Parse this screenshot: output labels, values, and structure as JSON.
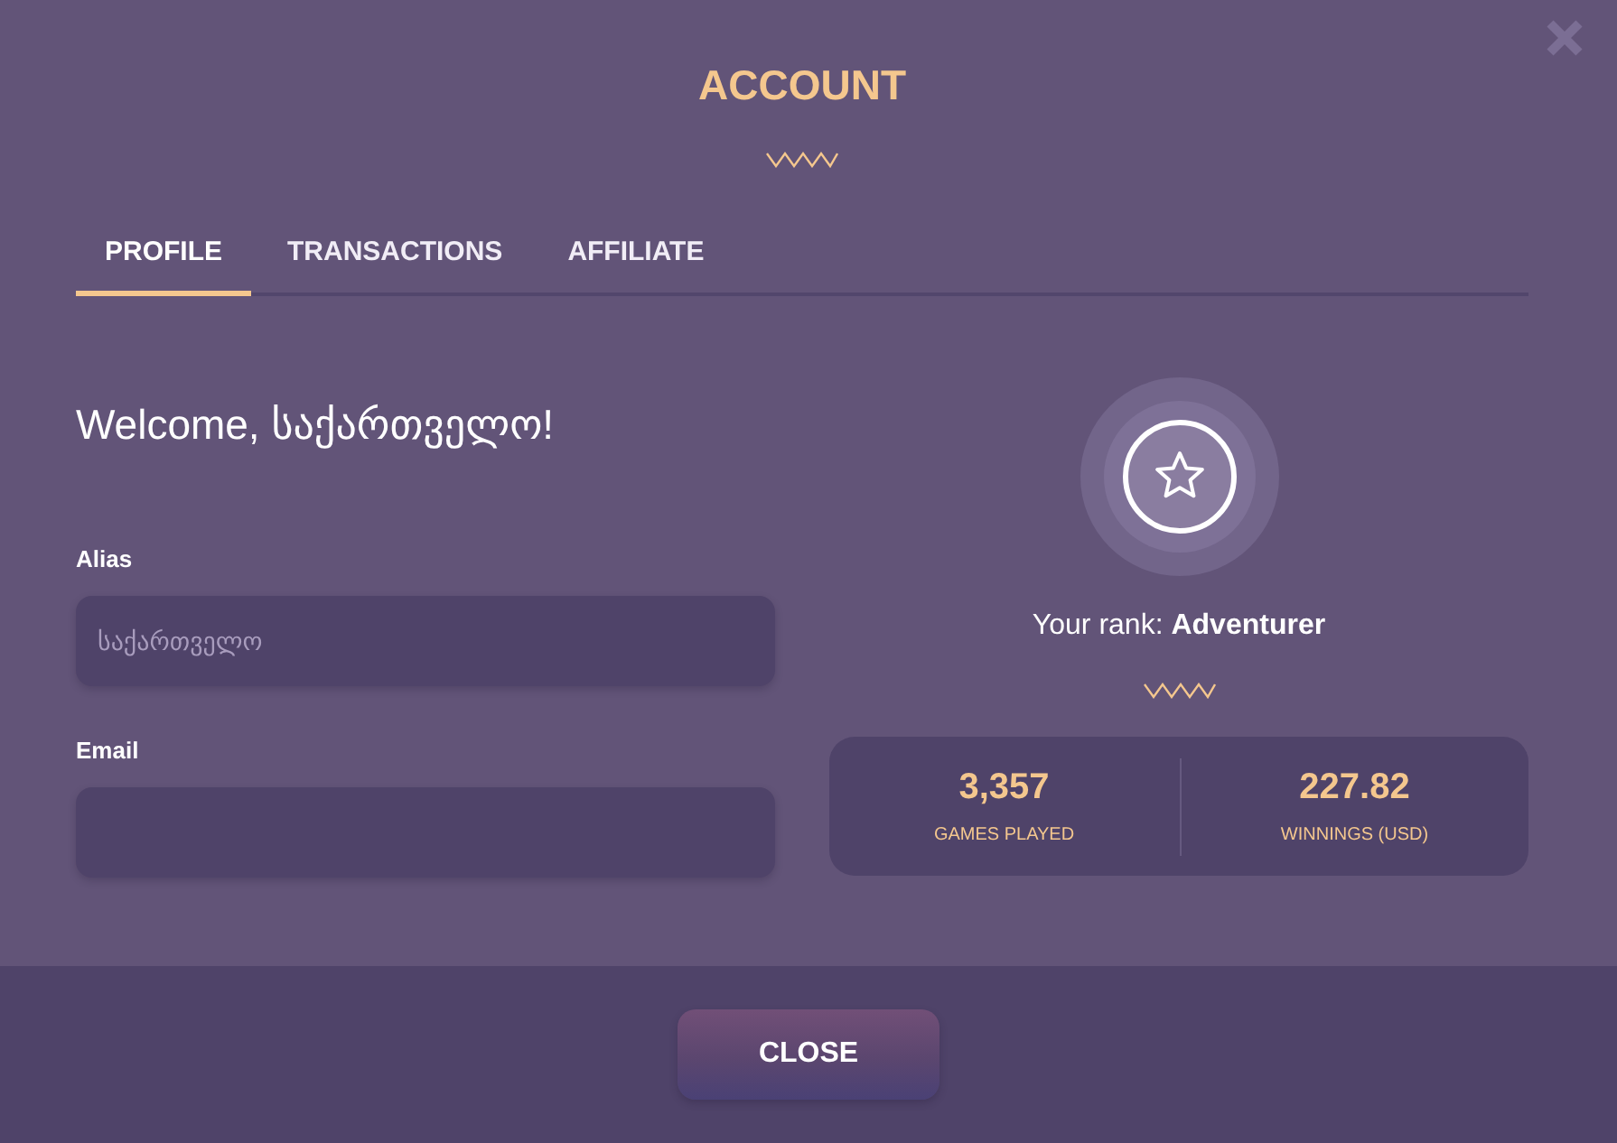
{
  "window": {
    "title": "ACCOUNT"
  },
  "tabs": [
    {
      "label": "PROFILE",
      "selected": true
    },
    {
      "label": "TRANSACTIONS",
      "selected": false
    },
    {
      "label": "AFFILIATE",
      "selected": false
    }
  ],
  "profile": {
    "greeting": "Welcome, საქართველო!",
    "fields": [
      {
        "label": "Alias",
        "placeholder": "საქართველო"
      },
      {
        "label": "Email"
      }
    ]
  },
  "rank": {
    "text": "Your rank: **Adventurer**",
    "stats": [
      {
        "value": "3,357",
        "label": "GAMES PLAYED"
      },
      {
        "value": "227.82",
        "label": "WINNINGS (USD)"
      }
    ]
  },
  "footer": {
    "button": "CLOSE"
  }
}
